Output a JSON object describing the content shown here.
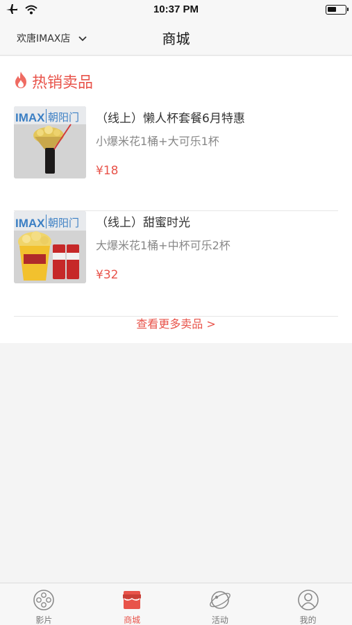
{
  "status_bar": {
    "time": "10:37 PM"
  },
  "nav": {
    "store_name": "欢唐IMAX店",
    "title": "商城"
  },
  "section": {
    "title": "热销卖品"
  },
  "products": [
    {
      "name": "（线上）懒人杯套餐6月特惠",
      "desc": "小爆米花1桶+大可乐1杯",
      "price": "¥18",
      "image_brand": "IMAX",
      "image_store": "朝阳门"
    },
    {
      "name": "（线上）甜蜜时光",
      "desc": "大爆米花1桶+中杯可乐2杯",
      "price": "¥32",
      "image_brand": "IMAX",
      "image_store": "朝阳门"
    }
  ],
  "more_link": "查看更多卖品 >",
  "tabs": [
    {
      "label": "影片",
      "icon": "film-reel-icon"
    },
    {
      "label": "商城",
      "icon": "store-icon",
      "active": true
    },
    {
      "label": "活动",
      "icon": "planet-icon"
    },
    {
      "label": "我的",
      "icon": "user-icon"
    }
  ],
  "colors": {
    "accent": "#e8534a",
    "tab_inactive": "#777777"
  }
}
